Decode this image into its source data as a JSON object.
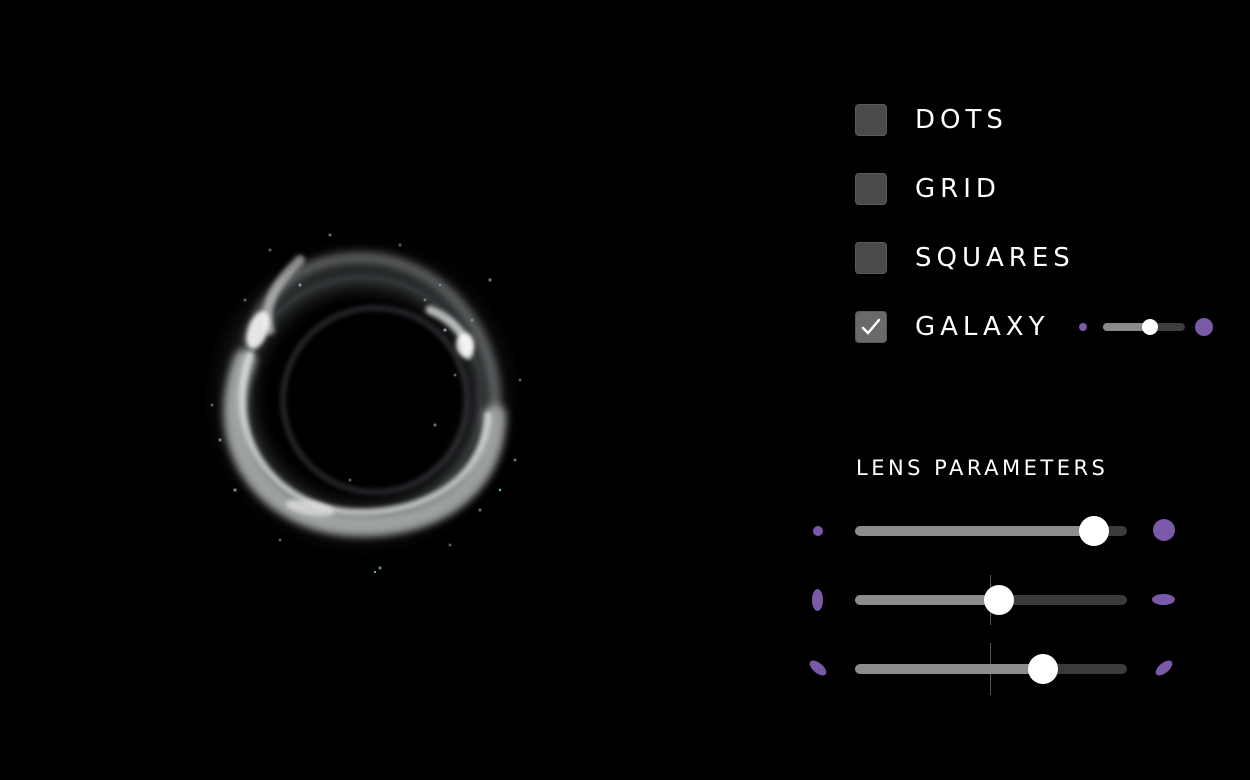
{
  "colors": {
    "background": "#000000",
    "accent": "#7a5aa8",
    "checkbox": "#4a4a4a",
    "track": "#3b3b3b",
    "fill": "#8c8c8c"
  },
  "view": {
    "image": "gravitationally lensed galaxy forming a bright ring"
  },
  "options": [
    {
      "label": "DOTS",
      "checked": false
    },
    {
      "label": "GRID",
      "checked": false
    },
    {
      "label": "SQUARES",
      "checked": false
    },
    {
      "label": "GALAXY",
      "checked": true
    }
  ],
  "galaxy_size": {
    "value": 0.57,
    "min_icon": "small-dot-icon",
    "max_icon": "large-dot-icon"
  },
  "lens_parameters": {
    "title": "LENS PARAMETERS",
    "sliders": [
      {
        "name": "lens-mass",
        "value": 0.88,
        "min_icon": "small-dot-icon",
        "max_icon": "large-dot-icon"
      },
      {
        "name": "lens-ellipticity",
        "value": 0.53,
        "centered": true,
        "min_icon": "vertical-ellipse-icon",
        "max_icon": "horizontal-ellipse-icon"
      },
      {
        "name": "lens-orientation",
        "value": 0.69,
        "centered": true,
        "min_icon": "ellipse-tilted-left-icon",
        "max_icon": "ellipse-tilted-right-icon"
      }
    ]
  }
}
